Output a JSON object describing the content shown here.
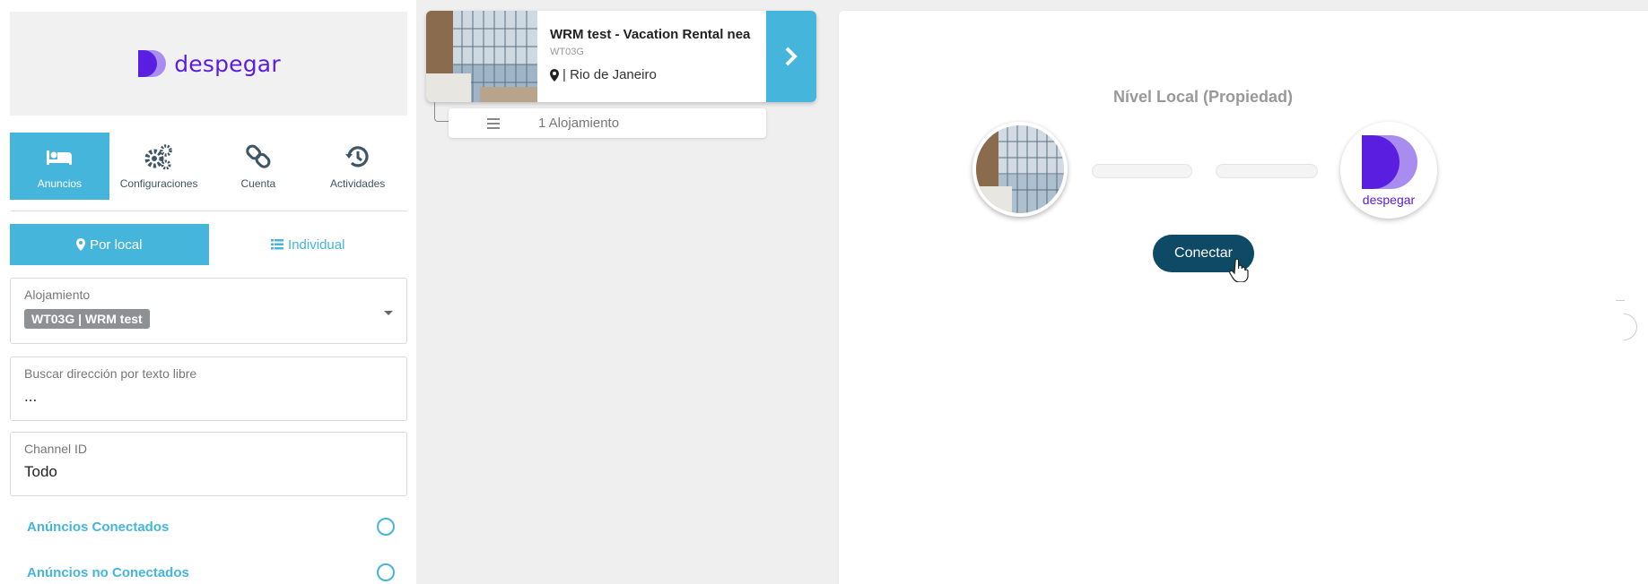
{
  "brand": {
    "name": "despegar",
    "color": "#5a1ee0"
  },
  "nav": [
    {
      "label": "Anuncios",
      "icon": "bed-icon",
      "active": true
    },
    {
      "label": "Configuraciones",
      "icon": "gears-icon",
      "active": false
    },
    {
      "label": "Cuenta",
      "icon": "link-icon",
      "active": false
    },
    {
      "label": "Actividades",
      "icon": "history-icon",
      "active": false
    }
  ],
  "view_toggle": {
    "local_label": "Por local",
    "individual_label": "Individual"
  },
  "filters": {
    "alojamiento": {
      "label": "Alojamiento",
      "chip": "WT03G | WRM test"
    },
    "search": {
      "label": "Buscar dirección por texto libre",
      "value": "..."
    },
    "channel": {
      "label": "Channel ID",
      "value": "Todo"
    },
    "connected_label": "Anúncios Conectados",
    "not_connected_label": "Anúncios no Conectados"
  },
  "listing": {
    "title": "WRM test - Vacation Rental nea",
    "code": "WT03G",
    "location": "| Rio de Janeiro",
    "sub_label": "1 Alojamiento"
  },
  "panel": {
    "title": "Nível Local (Propiedad)",
    "connect_label": "Conectar",
    "partner_logo_text": "despegar"
  },
  "colors": {
    "accent": "#45b5dc",
    "button_dark": "#0e4a66"
  }
}
